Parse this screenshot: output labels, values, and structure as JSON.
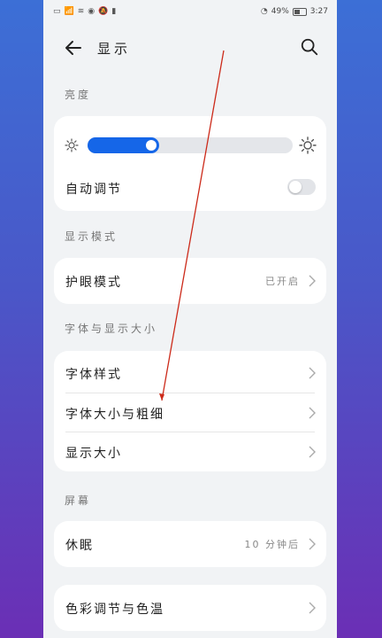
{
  "status_bar": {
    "left_icons": [
      "sim-icon",
      "signal-icon",
      "wifi-icon",
      "eye-icon",
      "mute-icon",
      "battery-saver-icon"
    ],
    "network_speed": "49%",
    "battery_icon": "battery-icon",
    "time": "3:27"
  },
  "header": {
    "title": "显示",
    "back_icon": "back-arrow-icon",
    "search_icon": "search-icon"
  },
  "brightness": {
    "section": "亮度",
    "level_fraction": 0.35,
    "auto_label": "自动调节",
    "auto_enabled": false
  },
  "display_mode": {
    "section": "显示模式",
    "eye_comfort_label": "护眼模式",
    "eye_comfort_value": "已开启"
  },
  "font_section": {
    "section": "字体与显示大小",
    "items": [
      {
        "label": "字体样式"
      },
      {
        "label": "字体大小与粗细"
      },
      {
        "label": "显示大小"
      }
    ]
  },
  "screen_section": {
    "section": "屏幕",
    "sleep_label": "休眠",
    "sleep_value": "10 分钟后"
  },
  "color_item": {
    "label": "色彩调节与色温"
  },
  "colors": {
    "accent": "#1566e8",
    "annotation_arrow": "#cc2a1a"
  }
}
